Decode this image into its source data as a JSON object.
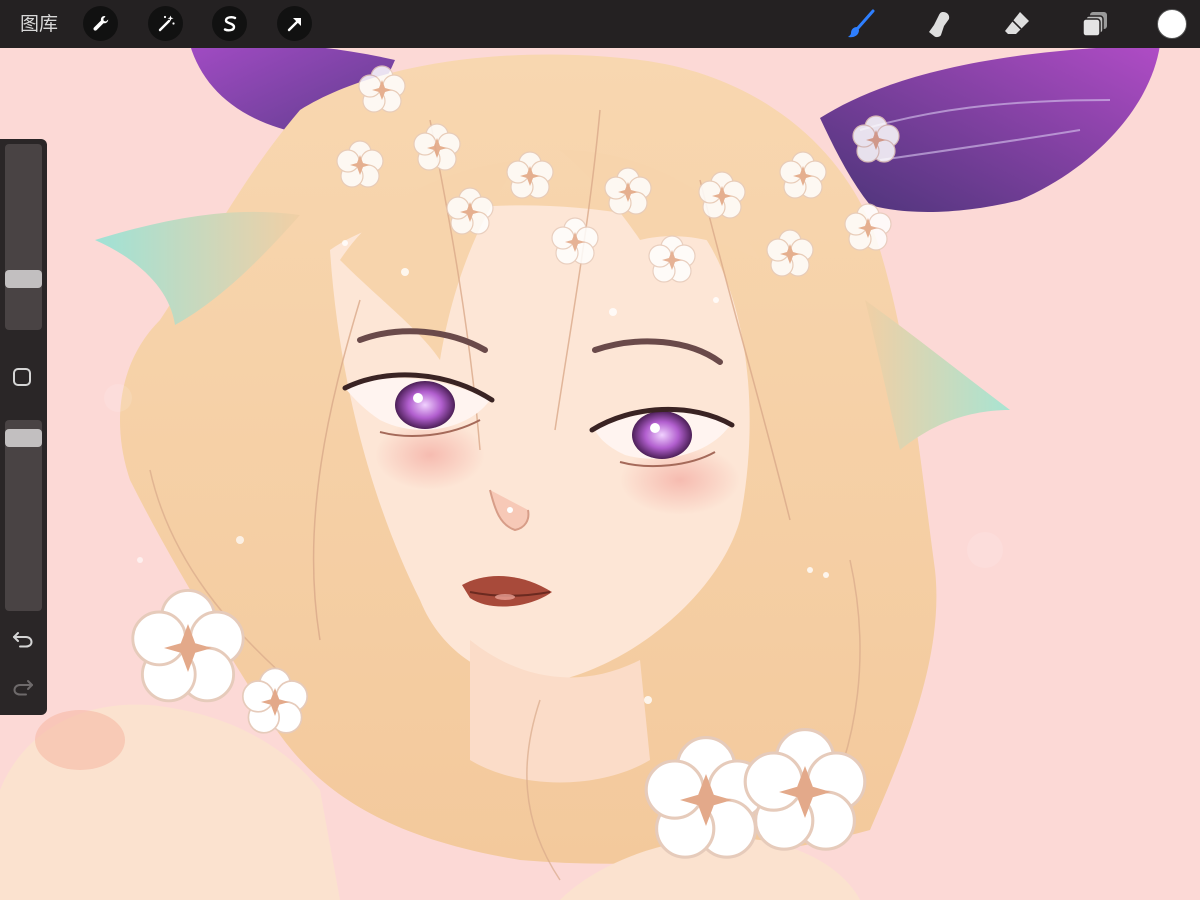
{
  "toolbar": {
    "gallery_label": "图库",
    "actions_icon": "wrench-icon",
    "adjustments_icon": "magic-wand-icon",
    "selection_icon": "selection-s-icon",
    "transform_icon": "arrow-cursor-icon",
    "brush_icon": "brush-icon",
    "smudge_icon": "smudge-finger-icon",
    "eraser_icon": "eraser-icon",
    "layers_icon": "layers-icon",
    "color": "#ffffff",
    "active_tool_color": "#2e7fff"
  },
  "sidebar": {
    "brush_size": 0.25,
    "opacity": 0.95,
    "modifier_icon": "square-modifier-icon",
    "undo_icon": "undo-icon",
    "redo_icon": "redo-icon"
  },
  "canvas": {
    "background_color": "#fcd9d6"
  }
}
